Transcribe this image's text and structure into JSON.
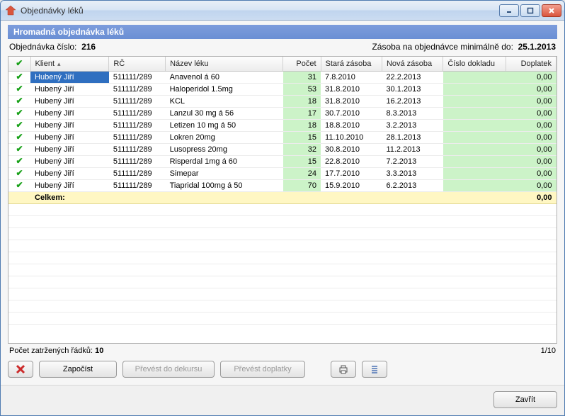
{
  "window": {
    "title": "Objednávky léků"
  },
  "section_title": "Hromadná objednávka léků",
  "meta": {
    "order_label": "Objednávka číslo:",
    "order_number": "216",
    "stock_label": "Zásoba na objednávce minimálně do:",
    "stock_date": "25.1.2013"
  },
  "columns": {
    "klient": "Klient",
    "rc": "RČ",
    "nazev": "Název léku",
    "pocet": "Počet",
    "stara": "Stará zásoba",
    "nova": "Nová zásoba",
    "cislo": "Číslo dokladu",
    "doplatek": "Doplatek"
  },
  "rows": [
    {
      "klient": "Hubený Jiří",
      "rc": "511111/289",
      "nazev": "Anavenol á 60",
      "pocet": "31",
      "stara": "7.8.2010",
      "nova": "22.2.2013",
      "cislo": "",
      "dop": "0,00"
    },
    {
      "klient": "Hubený Jiří",
      "rc": "511111/289",
      "nazev": "Haloperidol 1.5mg",
      "pocet": "53",
      "stara": "31.8.2010",
      "nova": "30.1.2013",
      "cislo": "",
      "dop": "0,00"
    },
    {
      "klient": "Hubený Jiří",
      "rc": "511111/289",
      "nazev": "KCL",
      "pocet": "18",
      "stara": "31.8.2010",
      "nova": "16.2.2013",
      "cislo": "",
      "dop": "0,00"
    },
    {
      "klient": "Hubený Jiří",
      "rc": "511111/289",
      "nazev": "Lanzul 30 mg á 56",
      "pocet": "17",
      "stara": "30.7.2010",
      "nova": "8.3.2013",
      "cislo": "",
      "dop": "0,00"
    },
    {
      "klient": "Hubený Jiří",
      "rc": "511111/289",
      "nazev": "Letizen 10 mg á 50",
      "pocet": "18",
      "stara": "18.8.2010",
      "nova": "3.2.2013",
      "cislo": "",
      "dop": "0,00"
    },
    {
      "klient": "Hubený Jiří",
      "rc": "511111/289",
      "nazev": "Lokren 20mg",
      "pocet": "15",
      "stara": "11.10.2010",
      "nova": "28.1.2013",
      "cislo": "",
      "dop": "0,00"
    },
    {
      "klient": "Hubený Jiří",
      "rc": "511111/289",
      "nazev": "Lusopress 20mg",
      "pocet": "32",
      "stara": "30.8.2010",
      "nova": "11.2.2013",
      "cislo": "",
      "dop": "0,00"
    },
    {
      "klient": "Hubený Jiří",
      "rc": "511111/289",
      "nazev": "Risperdal 1mg á 60",
      "pocet": "15",
      "stara": "22.8.2010",
      "nova": "7.2.2013",
      "cislo": "",
      "dop": "0,00"
    },
    {
      "klient": "Hubený Jiří",
      "rc": "511111/289",
      "nazev": "Simepar",
      "pocet": "24",
      "stara": "17.7.2010",
      "nova": "3.3.2013",
      "cislo": "",
      "dop": "0,00"
    },
    {
      "klient": "Hubený Jiří",
      "rc": "511111/289",
      "nazev": "Tiapridal 100mg á 50",
      "pocet": "70",
      "stara": "15.9.2010",
      "nova": "6.2.2013",
      "cislo": "",
      "dop": "0,00"
    }
  ],
  "total_row": {
    "label": "Celkem:",
    "value": "0,00"
  },
  "footer": {
    "count_label": "Počet zatržených řádků:",
    "count_value": "10",
    "page": "1/10"
  },
  "buttons": {
    "zapocist": "Započíst",
    "prevest_dekursu": "Převést do dekursu",
    "prevest_doplatky": "Převést doplatky",
    "zavrit": "Zavřít"
  }
}
